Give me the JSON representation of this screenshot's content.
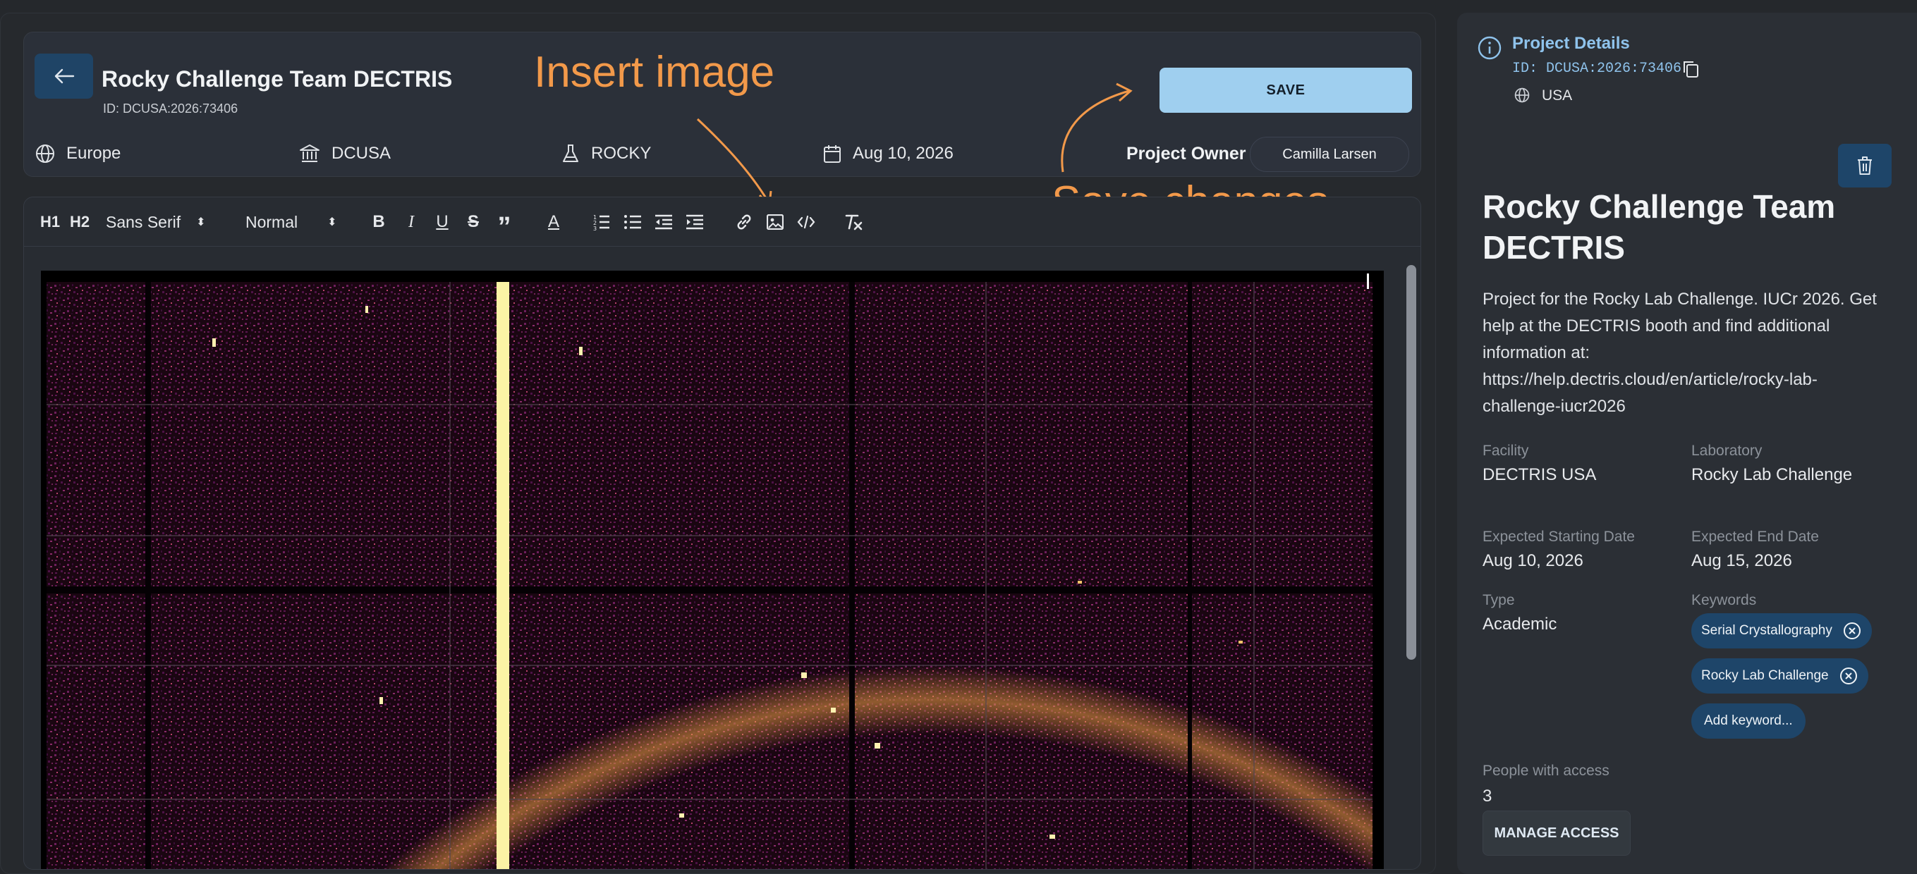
{
  "header": {
    "title": "Rocky Challenge Team DECTRIS",
    "id_label": "ID: DCUSA:2026:73406",
    "region": "Europe",
    "facility": "DCUSA",
    "lab": "ROCKY",
    "date": "Aug 10, 2026",
    "save_label": "SAVE",
    "owner_label": "Project Owner",
    "owner_name": "Camilla Larsen"
  },
  "annotations": {
    "insert_image": "Insert image",
    "save_changes": "Save changes"
  },
  "toolbar": {
    "h1": "H1",
    "h2": "H2",
    "font": "Sans Serif",
    "size": "Normal",
    "bold": "B",
    "italic": "I",
    "underline": "U",
    "strike": "S",
    "quote": "”",
    "color": "A"
  },
  "details": {
    "heading": "Project Details",
    "id": "ID: DCUSA:2026:73406",
    "country": "USA",
    "title": "Rocky Challenge Team DECTRIS",
    "description": "Project for the Rocky Lab Challenge. IUCr 2026. Get help at the DECTRIS booth and find additional information at: https://help.dectris.cloud/en/article/rocky-lab-challenge-iucr2026",
    "facility_label": "Facility",
    "facility_value": "DECTRIS USA",
    "laboratory_label": "Laboratory",
    "laboratory_value": "Rocky Lab Challenge",
    "start_label": "Expected Starting Date",
    "start_value": "Aug 10, 2026",
    "end_label": "Expected End Date",
    "end_value": "Aug 15, 2026",
    "type_label": "Type",
    "type_value": "Academic",
    "keywords_label": "Keywords",
    "keywords": [
      "Serial Crystallography",
      "Rocky Lab Challenge"
    ],
    "add_keyword": "Add keyword...",
    "people_label": "People with access",
    "people_value": "3",
    "manage_access": "MANAGE ACCESS"
  },
  "colors": {
    "accent": "#9fcfef",
    "annotation": "#f2994a",
    "chip": "#1e4569",
    "link_heading": "#8fc3ec"
  }
}
